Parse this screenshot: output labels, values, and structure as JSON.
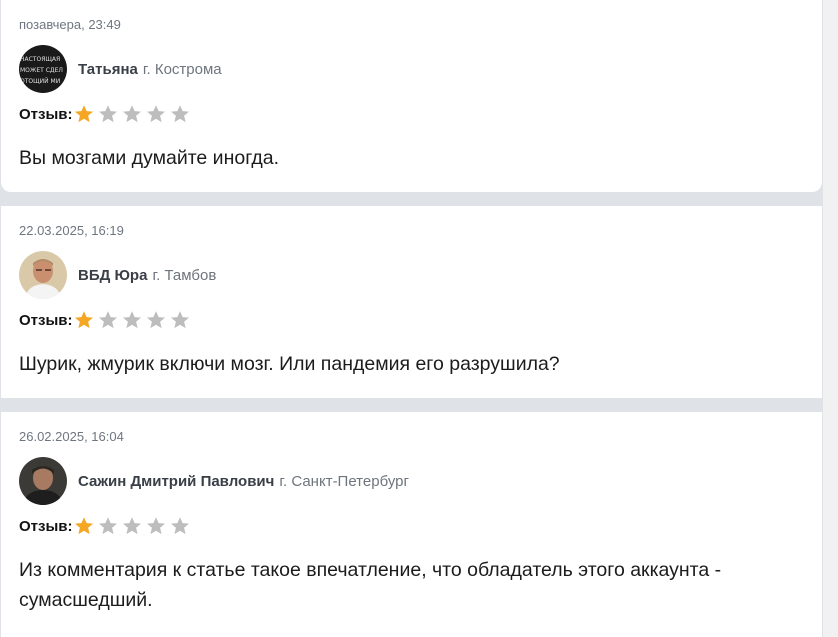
{
  "reviews": [
    {
      "date": "позавчера, 23:49",
      "author": "Татьяна",
      "city": "г. Кострома",
      "rating_label": "Отзыв:",
      "rating": 1,
      "max_rating": 5,
      "text": "Вы мозгами думайте иногда.",
      "avatar_text": [
        "НАСТОЯЩАЯ",
        "МОЖЕТ СДЕЛ",
        "ОТОЩИЙ МИ"
      ]
    },
    {
      "date": "22.03.2025, 16:19",
      "author": "ВБД Юра",
      "city": "г. Тамбов",
      "rating_label": "Отзыв:",
      "rating": 1,
      "max_rating": 5,
      "text": "Шурик, жмурик включи мозг. Или пандемия его разрушила?"
    },
    {
      "date": "26.02.2025, 16:04",
      "author": "Сажин Дмитрий Павлович",
      "city": "г. Санкт-Петербург",
      "rating_label": "Отзыв:",
      "rating": 1,
      "max_rating": 5,
      "text": "Из комментария к статье такое впечатление, что обладатель этого аккаунта - сумасшедший."
    }
  ],
  "colors": {
    "star_filled": "#f5a623",
    "star_empty": "#bdbdbd",
    "page_bg": "#dfe3e8"
  }
}
